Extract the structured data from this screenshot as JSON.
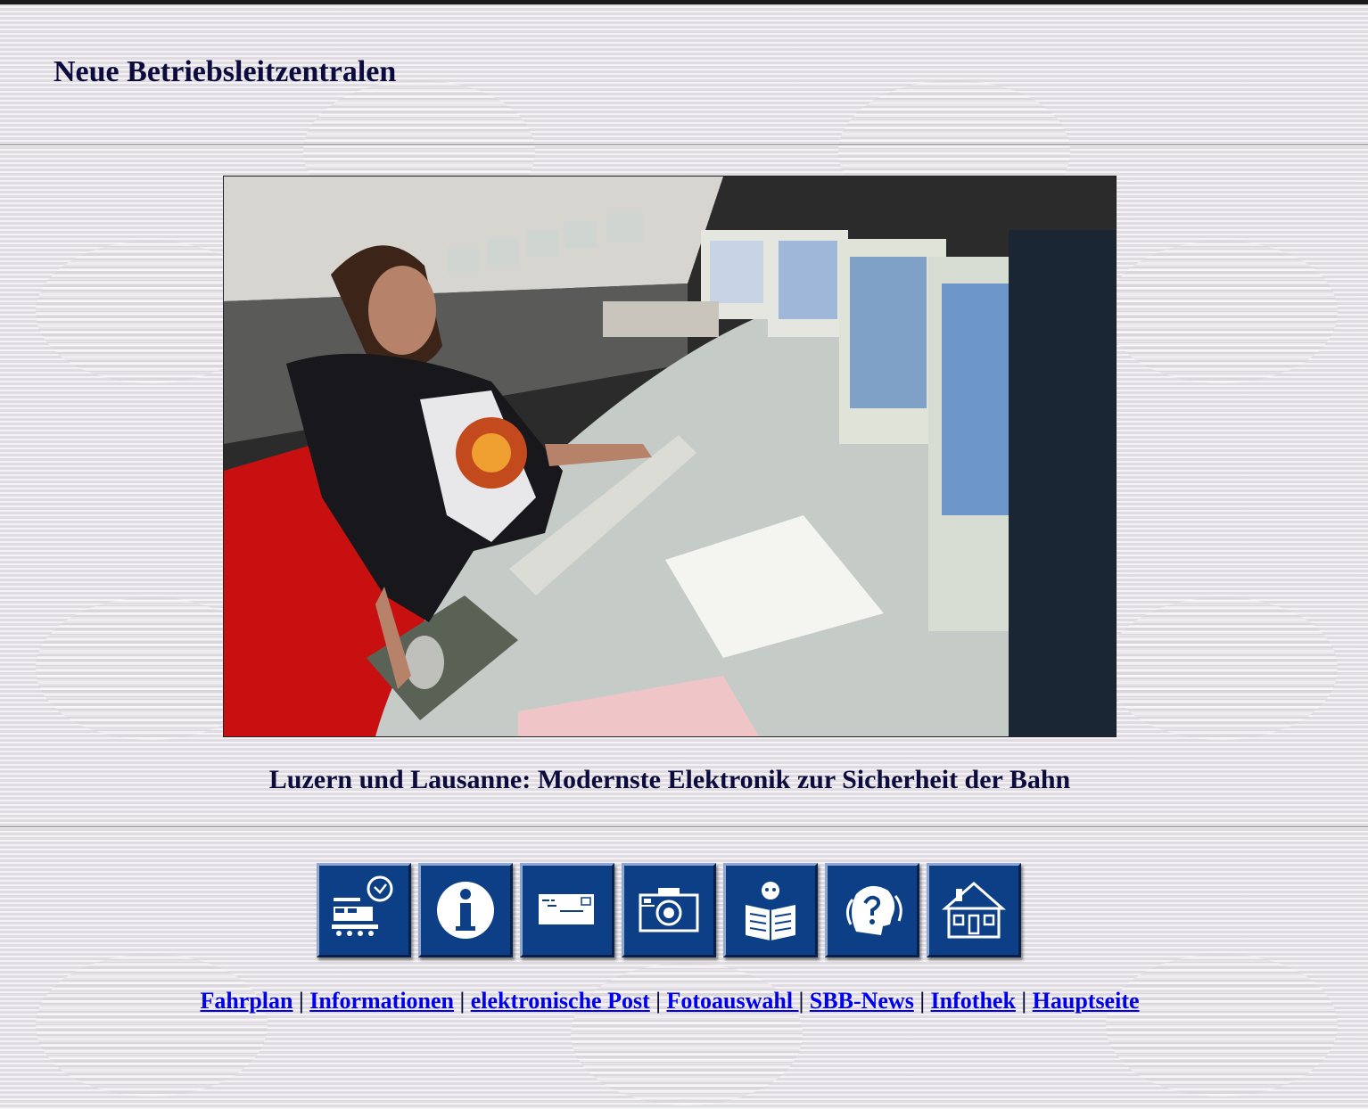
{
  "page": {
    "title": "Neue Betriebsleitzentralen",
    "caption": "Luzern und Lausanne: Modernste Elektronik zur Sicherheit der Bahn"
  },
  "photo": {
    "description_icon": "photo-operator-control-center"
  },
  "nav_icons": [
    {
      "label": "Fahrplan",
      "icon": "train-clock-icon"
    },
    {
      "label": "Informationen",
      "icon": "info-icon"
    },
    {
      "label": "elektronische Post",
      "icon": "envelope-icon"
    },
    {
      "label": "Fotoauswahl",
      "icon": "camera-icon"
    },
    {
      "label": "SBB-News",
      "icon": "newspaper-reader-icon"
    },
    {
      "label": "Infothek",
      "icon": "question-head-icon"
    },
    {
      "label": "Hauptseite",
      "icon": "house-icon"
    }
  ],
  "text_links": [
    {
      "label": "Fahrplan"
    },
    {
      "label": "Informationen"
    },
    {
      "label": "elektronische Post"
    },
    {
      "label": "Fotoauswahl "
    },
    {
      "label": "SBB-News"
    },
    {
      "label": "Infothek"
    },
    {
      "label": "Hauptseite"
    }
  ],
  "separator": "|",
  "colors": {
    "heading": "#0b0b3d",
    "link": "#0000ee",
    "icon_bg": "#0d3f86",
    "background": "#e4e3e6"
  }
}
